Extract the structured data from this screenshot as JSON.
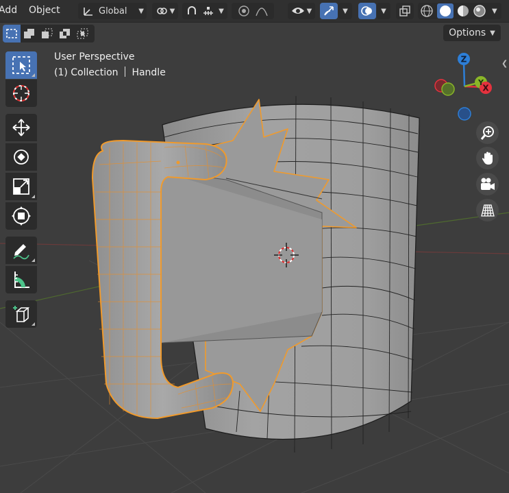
{
  "header": {
    "menu_add": "Add",
    "menu_object": "Object",
    "orientation_label": "Global",
    "icons": [
      "orientation-axes-icon",
      "chevron-down-icon",
      "pivot-link-icon",
      "snap-magnet-icon",
      "snap-grid-icon",
      "proportional-edit-icon",
      "falloff-curve-icon",
      "visibility-eye-icon",
      "gizmo-arrows-icon",
      "overlay-circles-icon",
      "xray-toggle-icon",
      "shading-wireframe-icon",
      "shading-solid-icon",
      "shading-material-icon",
      "shading-rendered-icon"
    ]
  },
  "subheader": {
    "options_label": "Options",
    "select_modes": [
      "select-new-icon",
      "select-extend-icon",
      "select-subtract-icon",
      "select-difference-icon",
      "select-intersect-icon"
    ]
  },
  "toolbar": {
    "tools": [
      "select-box-tool",
      "cursor-tool",
      "move-tool",
      "rotate-tool",
      "scale-tool",
      "transform-tool",
      "annotate-tool",
      "measure-tool",
      "add-cube-tool"
    ],
    "active": "select-box-tool"
  },
  "viewport": {
    "perspective": "User Perspective",
    "collection": "(1) Collection",
    "object_name": "Handle"
  },
  "gizmo": {
    "z_label": "Z",
    "y_label": "Y",
    "x_label": "X",
    "colors": {
      "x": "#e5323e",
      "y": "#8ab628",
      "z": "#2d7fd8",
      "selection": "#f09a2c",
      "background": "#3d3d3d"
    }
  },
  "nav_buttons": [
    "zoom-icon",
    "pan-hand-icon",
    "camera-icon",
    "ortho-grid-icon"
  ]
}
